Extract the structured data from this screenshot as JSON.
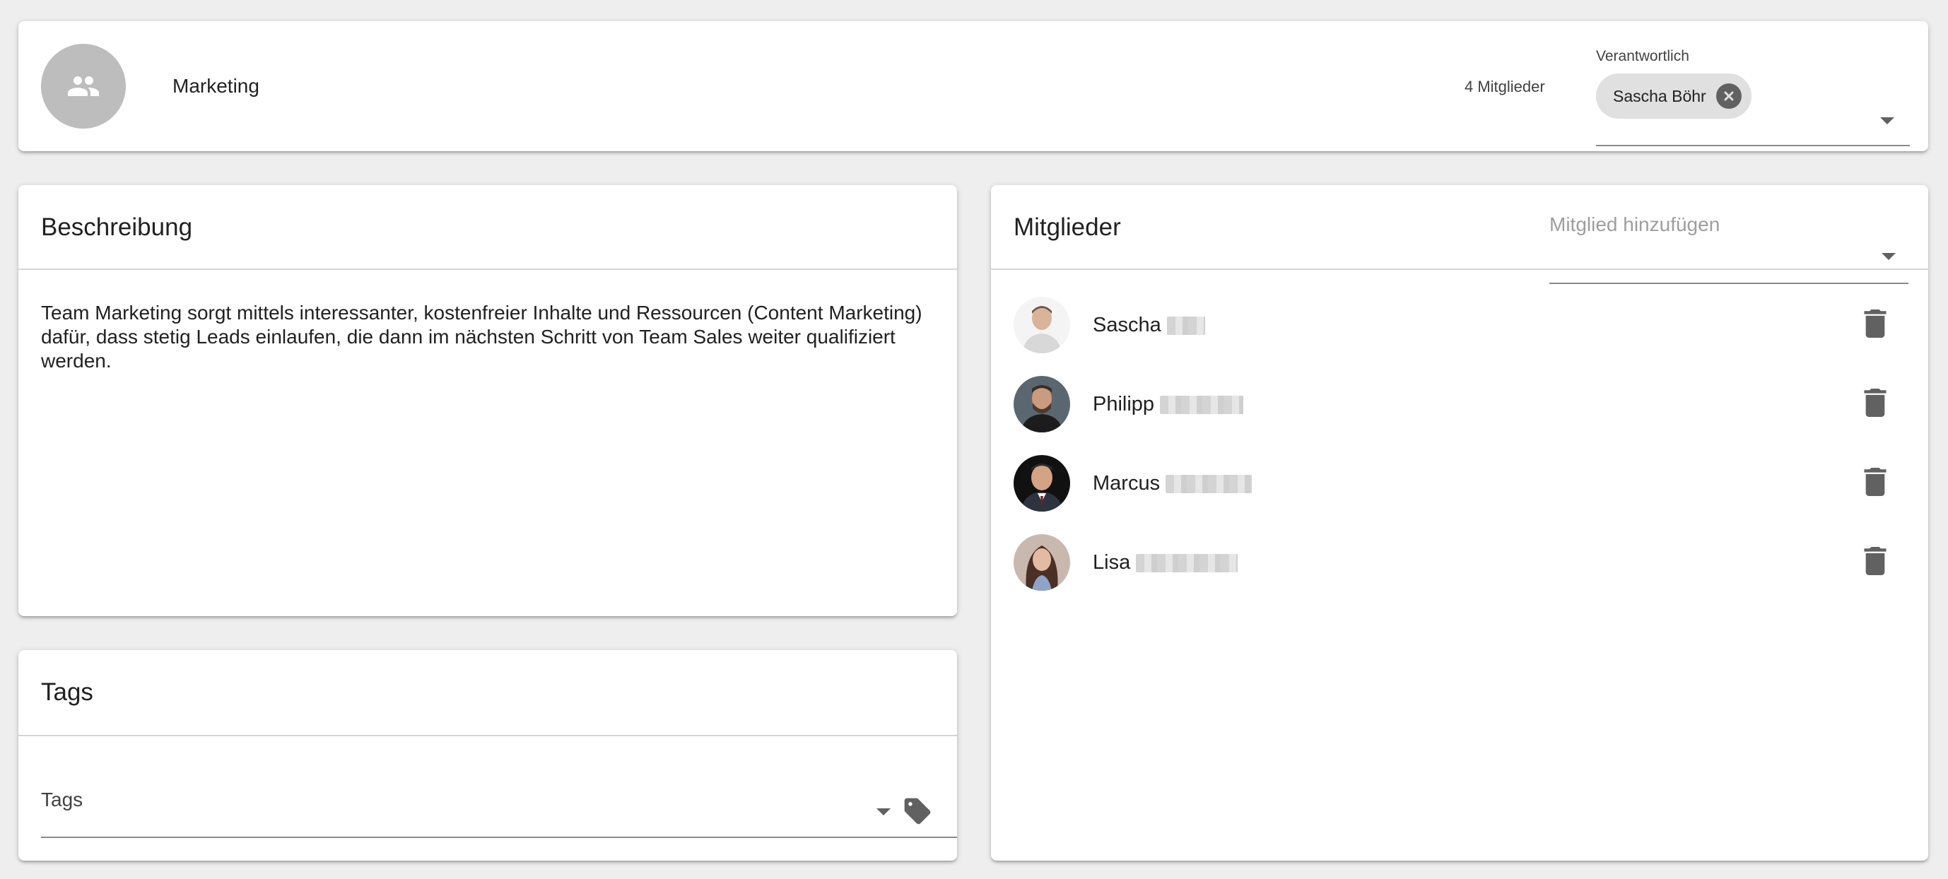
{
  "header": {
    "team_name": "Marketing",
    "member_count": "4 Mitglieder",
    "responsible_label": "Verantwortlich",
    "responsible_value": "Sascha Böhr",
    "team_icon": "group-icon"
  },
  "description": {
    "title": "Beschreibung",
    "text": "Team Marketing sorgt mittels interessanter, kostenfreier Inhalte und Ressourcen (Content Marketing) dafür, dass stetig Leads einlaufen, die dann im nächsten Schritt von Team Sales weiter qualifiziert werden."
  },
  "tags": {
    "title": "Tags",
    "field_label": "Tags",
    "icon": "tag-icon"
  },
  "members": {
    "title": "Mitglieder",
    "add_placeholder": "Mitglied hinzufügen",
    "items": [
      {
        "first_name": "Sascha",
        "avatar": "photo-man-light-shirt"
      },
      {
        "first_name": "Philipp",
        "avatar": "photo-man-beard"
      },
      {
        "first_name": "Marcus",
        "avatar": "photo-man-suit"
      },
      {
        "first_name": "Lisa",
        "avatar": "photo-woman-long-hair"
      }
    ],
    "delete_icon": "trash-icon"
  },
  "colors": {
    "background": "#eeeeee",
    "card": "#ffffff",
    "chip": "#e0e0e0",
    "icon": "#616161",
    "avatar_placeholder": "#bdbdbd"
  }
}
